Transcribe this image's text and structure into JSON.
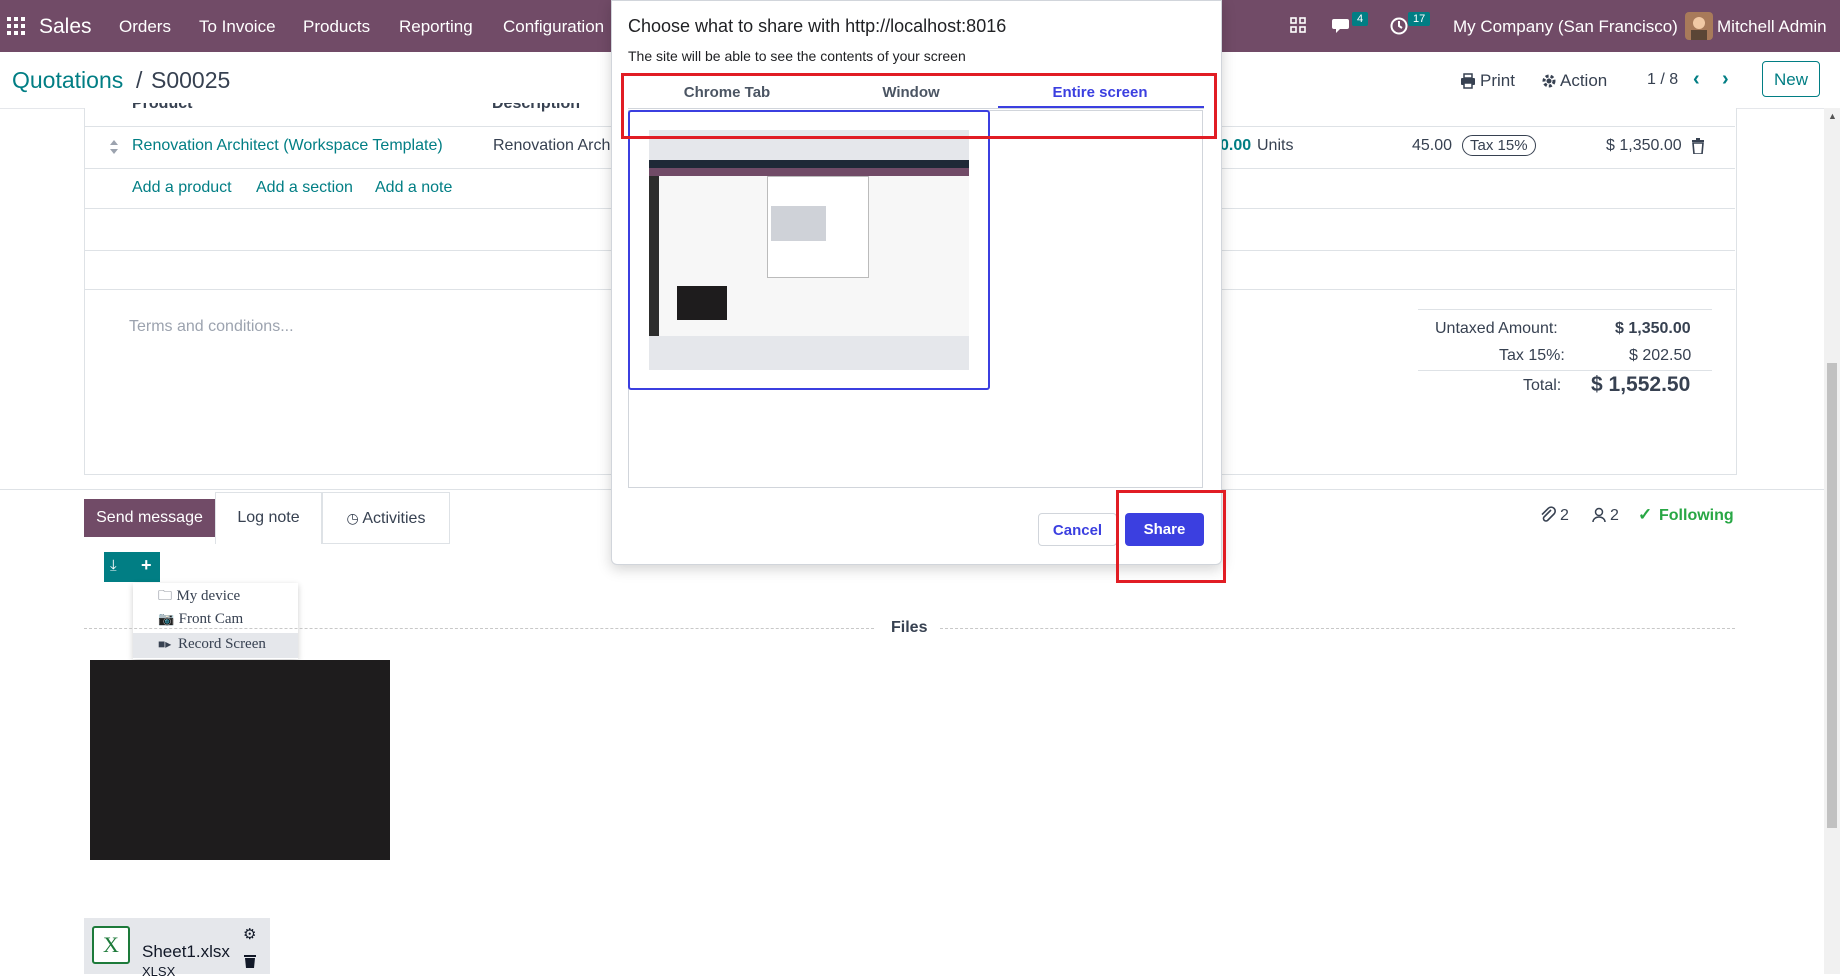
{
  "navbar": {
    "app_name": "Sales",
    "menu": [
      "Orders",
      "To Invoice",
      "Products",
      "Reporting",
      "Configuration"
    ],
    "messages_count": "4",
    "activities_count": "17",
    "company": "My Company (San Francisco)",
    "user": "Mitchell Admin"
  },
  "breadcrumb": {
    "parent": "Quotations",
    "separator": "/",
    "current": "S00025"
  },
  "control": {
    "print": "Print",
    "action": "Action",
    "pager": "1 / 8",
    "new": "New"
  },
  "order_line": {
    "header_product": "Product",
    "header_description": "Description",
    "product": "Renovation Architect (Workspace Template)",
    "description": "Renovation Arch",
    "qty_partial": "0.00",
    "uom": "Units",
    "unit_price": "45.00",
    "tax": "Tax 15%",
    "subtotal": "$ 1,350.00"
  },
  "line_actions": {
    "add_product": "Add a product",
    "add_section": "Add a section",
    "add_note": "Add a note"
  },
  "terms_placeholder": "Terms and conditions...",
  "totals": {
    "untaxed_label": "Untaxed Amount:",
    "untaxed_value": "$ 1,350.00",
    "tax_label": "Tax 15%:",
    "tax_value": "$ 202.50",
    "total_label": "Total:",
    "total_value": "$ 1,552.50"
  },
  "chatter": {
    "send_message": "Send message",
    "log_note": "Log note",
    "activities": "Activities",
    "attachments_count": "2",
    "followers_count": "2",
    "following": "Following"
  },
  "upload_menu": {
    "items": [
      "My device",
      "Front Cam",
      "Record Screen"
    ]
  },
  "files_label": "Files",
  "attachment": {
    "name": "Sheet1.xlsx",
    "ext": "XLSX"
  },
  "share_dialog": {
    "title": "Choose what to share with http://localhost:8016",
    "subtitle": "The site will be able to see the contents of your screen",
    "tabs": [
      "Chrome Tab",
      "Window",
      "Entire screen"
    ],
    "active_tab": "Entire screen",
    "cancel": "Cancel",
    "share": "Share"
  },
  "colors": {
    "brand": "#714b67",
    "teal": "#017e84",
    "share_blue": "#3b3fe0",
    "highlight_red": "#e11d24"
  }
}
